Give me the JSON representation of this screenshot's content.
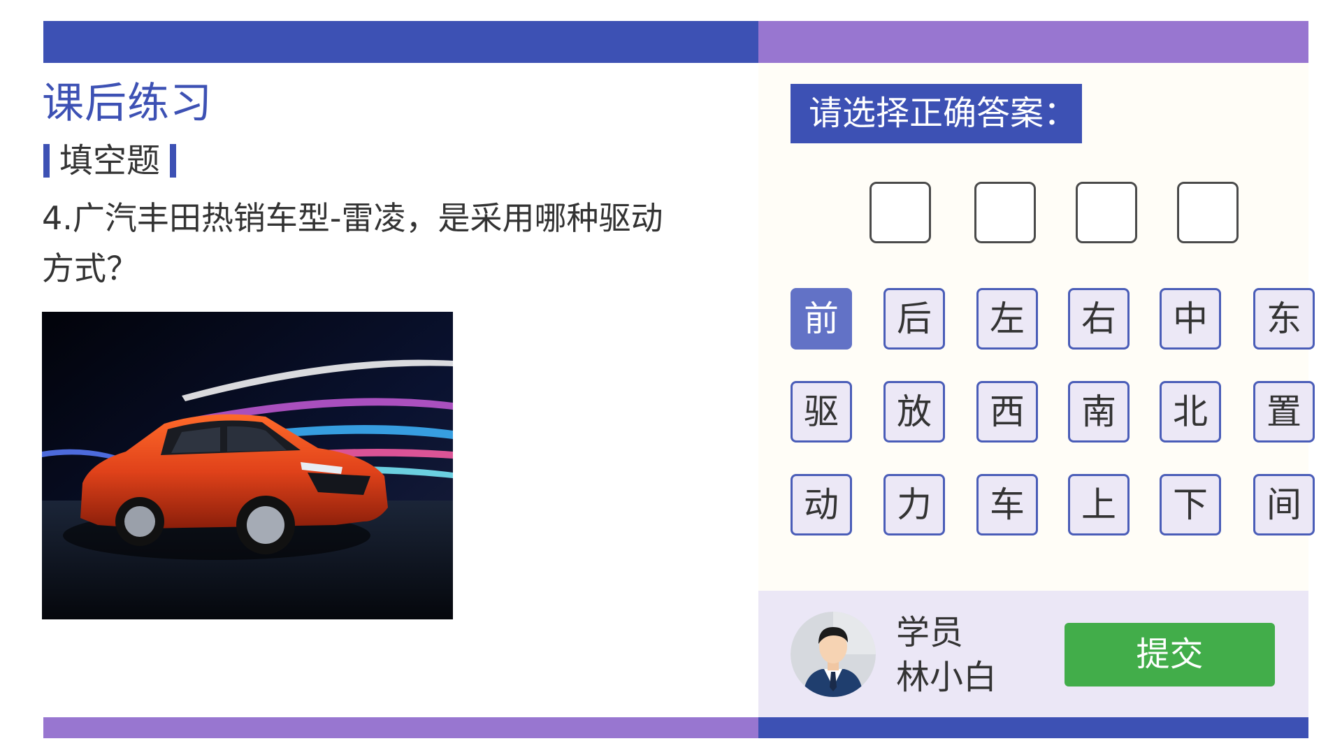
{
  "lesson": {
    "title": "课后练习"
  },
  "section": {
    "label": "填空题"
  },
  "question": {
    "text": "4.广汽丰田热销车型-雷凌，是采用哪种驱动方式？"
  },
  "prompt": {
    "text": "请选择正确答案："
  },
  "answer_slots": [
    "",
    "",
    "",
    ""
  ],
  "options": {
    "row1": [
      "前",
      "后",
      "左",
      "右",
      "中",
      "东"
    ],
    "row2": [
      "驱",
      "放",
      "西",
      "南",
      "北",
      "置"
    ],
    "row3": [
      "动",
      "力",
      "车",
      "上",
      "下",
      "间"
    ]
  },
  "selected_option": "前",
  "student": {
    "role": "学员",
    "name": "林小白"
  },
  "submit": {
    "label": "提交"
  },
  "colors": {
    "primary": "#3d51b4",
    "accent": "#9876d0",
    "option_bg": "#ece8f6",
    "selected": "#6272c6",
    "submit": "#42ad4a"
  },
  "icons": {
    "avatar": "student-avatar-icon"
  }
}
